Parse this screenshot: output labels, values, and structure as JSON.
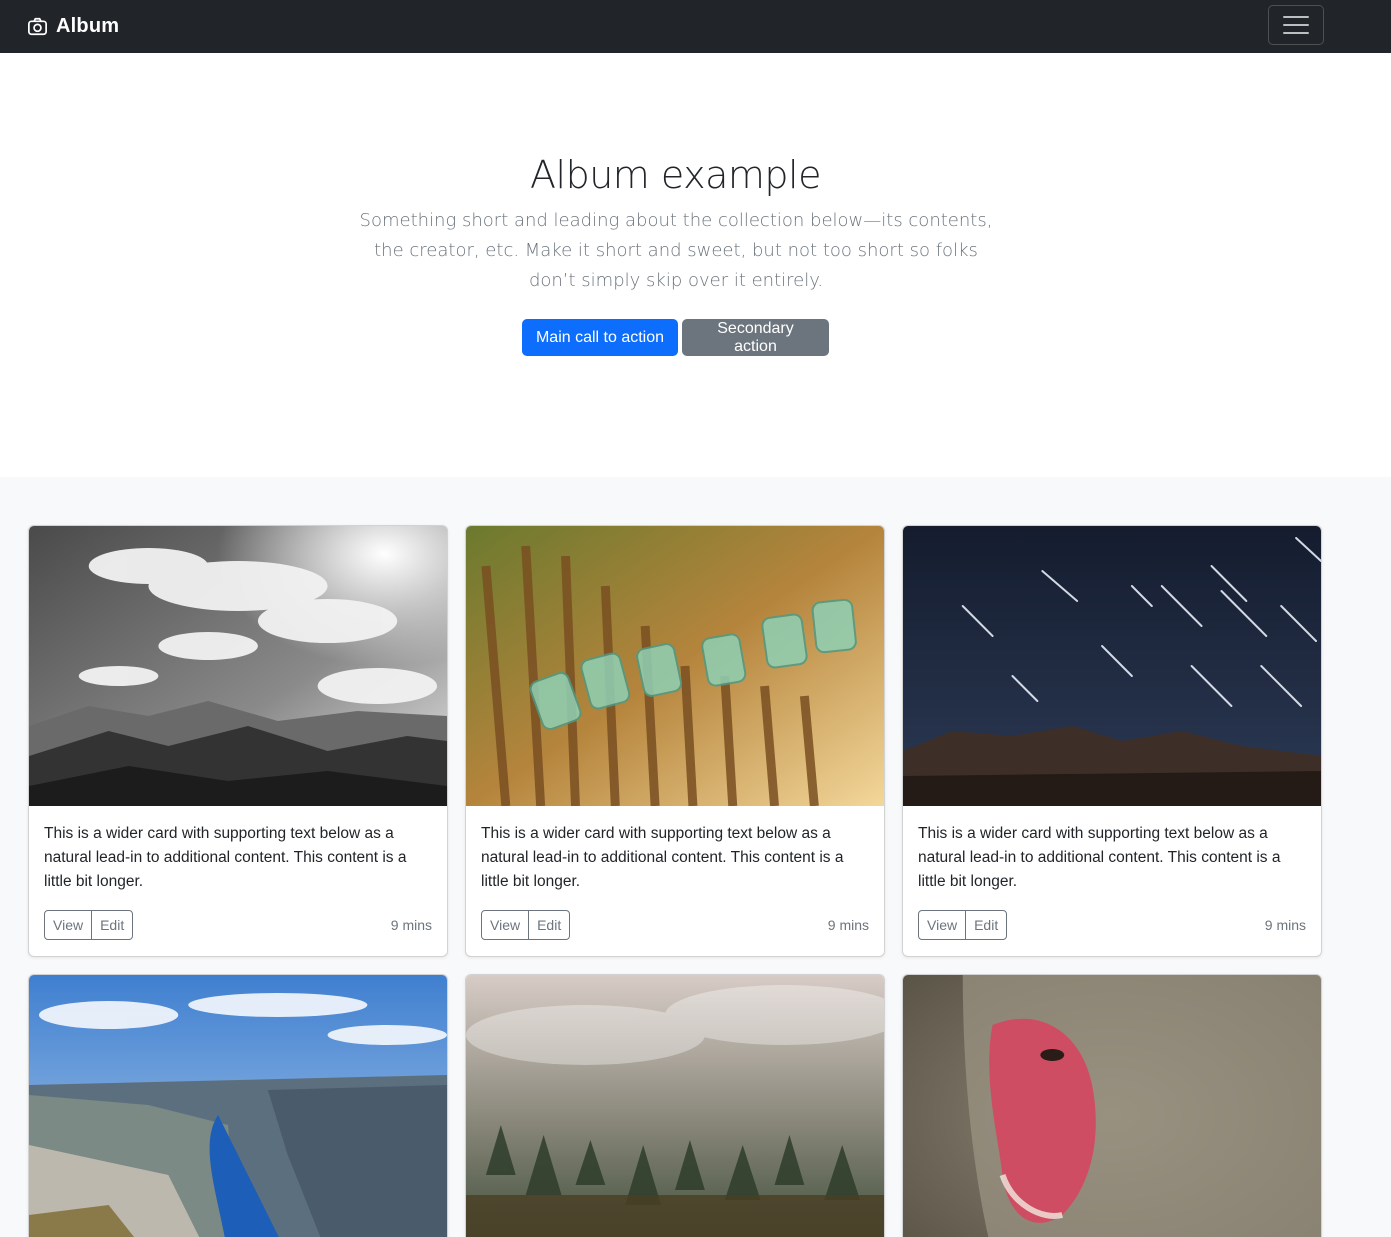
{
  "navbar": {
    "brand": "Album",
    "brand_icon": "camera-icon",
    "toggler_icon": "hamburger-menu-icon"
  },
  "hero": {
    "title": "Album example",
    "lead": "Something short and leading about the collection below—its contents, the creator, etc. Make it short and sweet, but not too short so folks don’t simply skip over it entirely.",
    "primary_button": "Main call to action",
    "secondary_button": "Secondary action"
  },
  "cards": [
    {
      "image": "black-and-white-mountain-clouds",
      "text": "This is a wider card with supporting text below as a natural lead-in to additional content. This content is a little bit longer.",
      "view": "View",
      "edit": "Edit",
      "time": "9 mins"
    },
    {
      "image": "green-glass-jars-on-fence",
      "text": "This is a wider card with supporting text below as a natural lead-in to additional content. This content is a little bit longer.",
      "view": "View",
      "edit": "Edit",
      "time": "9 mins"
    },
    {
      "image": "star-trails-night-sky",
      "text": "This is a wider card with supporting text below as a natural lead-in to additional content. This content is a little bit longer.",
      "view": "View",
      "edit": "Edit",
      "time": "9 mins"
    },
    {
      "image": "fjord-cliff-landscape"
    },
    {
      "image": "misty-forest"
    },
    {
      "image": "snow-monkey-face"
    }
  ],
  "colors": {
    "navbar_bg": "#212529",
    "primary": "#0d6efd",
    "secondary": "#6c757d",
    "album_bg": "#f8f9fa"
  }
}
